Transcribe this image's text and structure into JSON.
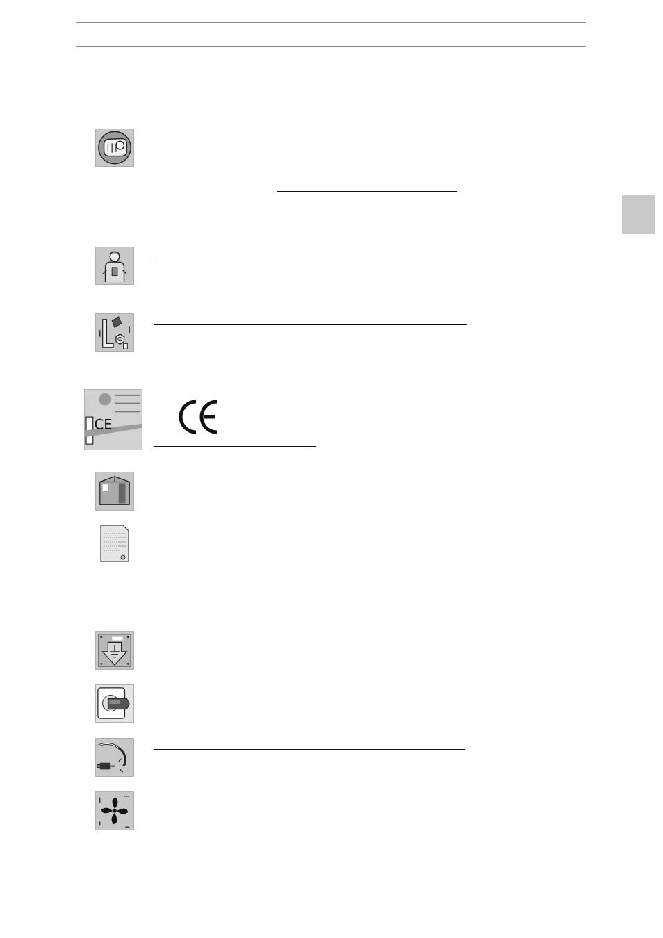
{
  "icons": [
    "pointing-hand-icon",
    "technician-icon",
    "parts-icon",
    "oven-ce-icon",
    "package-icon",
    "document-icon",
    "grounding-icon",
    "plug-socket-icon",
    "damaged-cable-icon",
    "fan-icon"
  ],
  "ce_mark": "CE",
  "colors": {
    "tab": "#c9c9c9",
    "icon_bg": "#c8c8c8",
    "rule": "#8a8a8a"
  }
}
